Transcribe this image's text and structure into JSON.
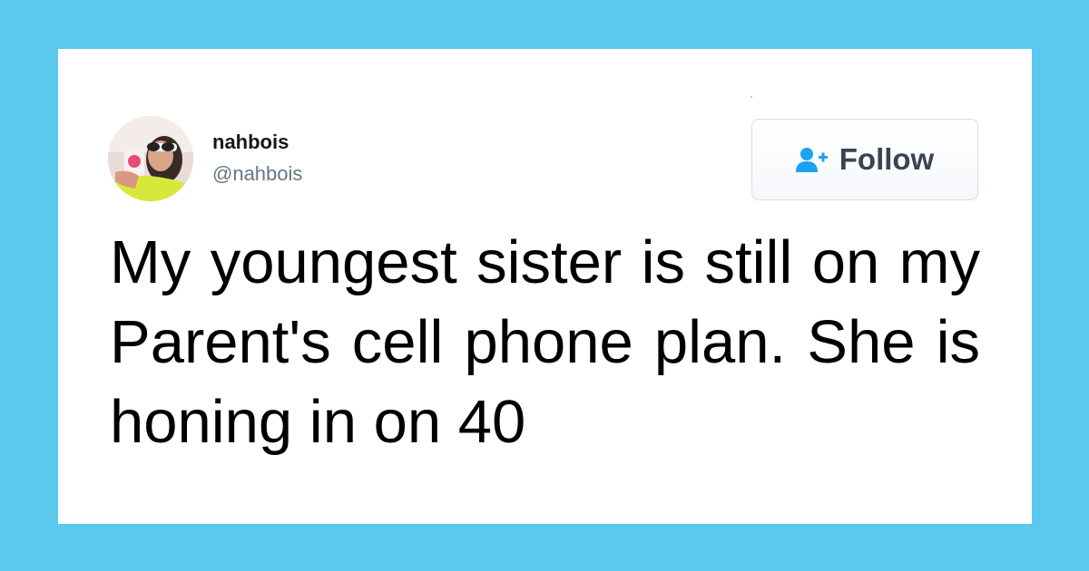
{
  "tweet": {
    "user": {
      "name": "nahbois",
      "handle": "@nahbois"
    },
    "follow_button": {
      "label": "Follow",
      "icon": "add-user-icon"
    },
    "text": "My youngest sister is still on my Parent's cell phone plan. She is honing in on 40"
  },
  "colors": {
    "background": "#5bc8ee",
    "card": "#ffffff",
    "accent": "#1da1f2",
    "handle": "#657786",
    "button_text": "#3a4450"
  }
}
